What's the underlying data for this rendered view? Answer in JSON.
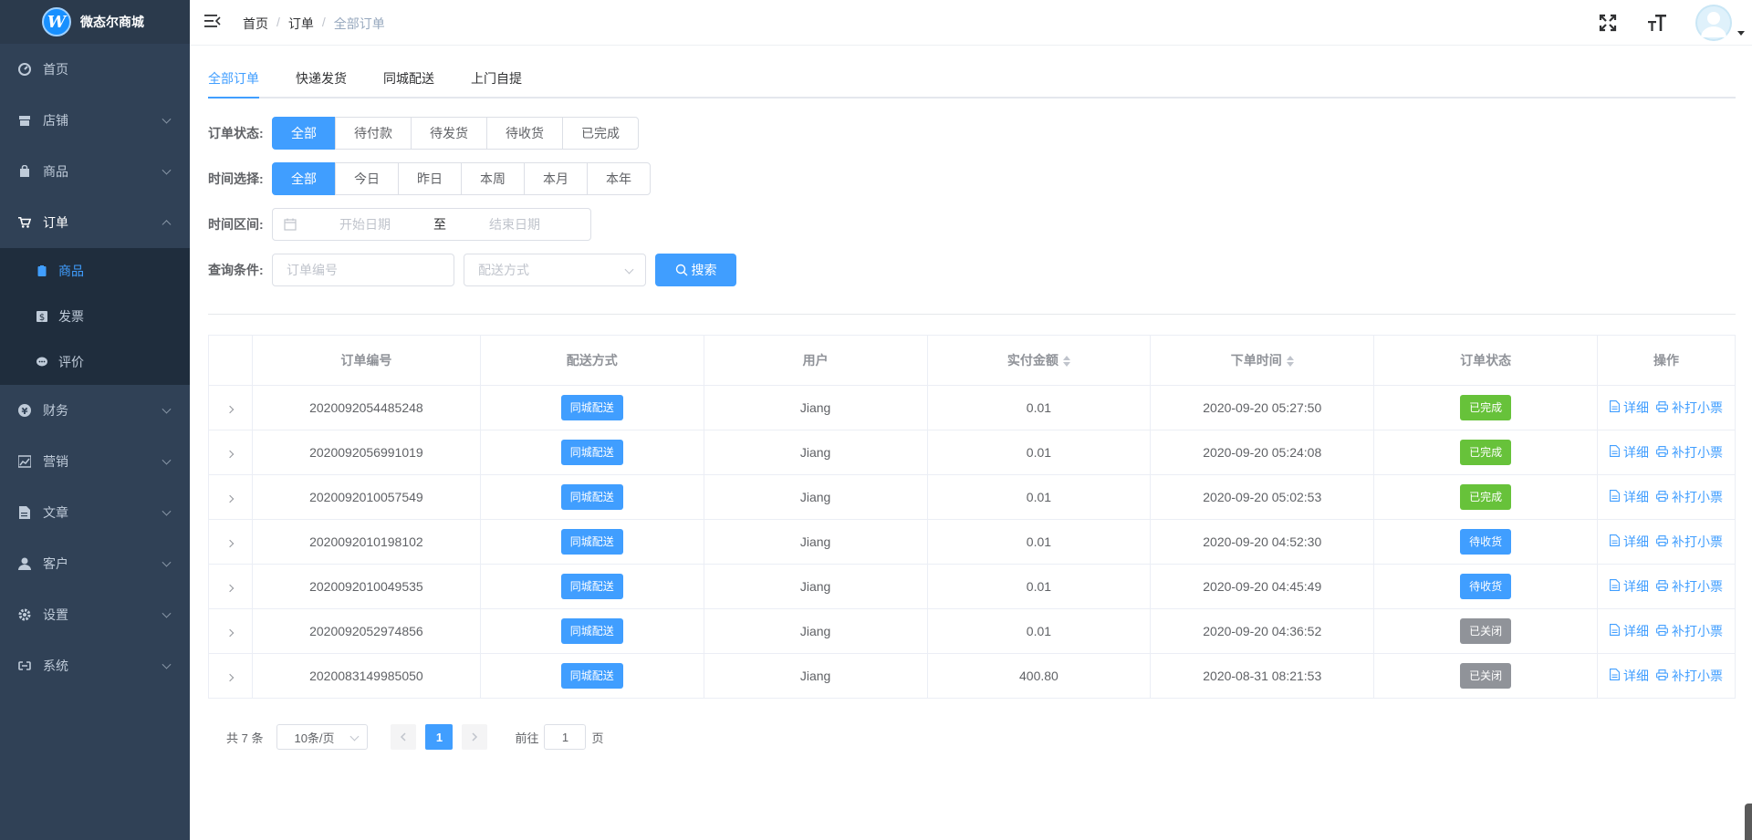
{
  "sidebar": {
    "logo_text": "微态尔商城",
    "logo_mark": "W",
    "items": [
      {
        "label": "首页",
        "icon": "dashboard-icon"
      },
      {
        "label": "店铺",
        "icon": "store-icon"
      },
      {
        "label": "商品",
        "icon": "bag-icon"
      },
      {
        "label": "订单",
        "icon": "cart-icon"
      },
      {
        "label": "财务",
        "icon": "yen-icon"
      },
      {
        "label": "营销",
        "icon": "chart-icon"
      },
      {
        "label": "文章",
        "icon": "document-icon"
      },
      {
        "label": "客户",
        "icon": "user-icon"
      },
      {
        "label": "设置",
        "icon": "gear-icon"
      },
      {
        "label": "系统",
        "icon": "link-icon"
      }
    ],
    "order_sub": [
      {
        "label": "商品",
        "icon": "clipboard-icon"
      },
      {
        "label": "发票",
        "icon": "invoice-icon"
      },
      {
        "label": "评价",
        "icon": "comment-icon"
      }
    ]
  },
  "header": {
    "breadcrumb": [
      "首页",
      "订单",
      "全部订单"
    ]
  },
  "tabs": [
    "全部订单",
    "快递发货",
    "同城配送",
    "上门自提"
  ],
  "filters": {
    "status_label": "订单状态:",
    "status_options": [
      "全部",
      "待付款",
      "待发货",
      "待收货",
      "已完成"
    ],
    "time_label": "时间选择:",
    "time_options": [
      "全部",
      "今日",
      "昨日",
      "本周",
      "本月",
      "本年"
    ],
    "range_label": "时间区间:",
    "start_placeholder": "开始日期",
    "range_to": "至",
    "end_placeholder": "结束日期",
    "query_label": "查询条件:",
    "order_no_placeholder": "订单编号",
    "delivery_placeholder": "配送方式",
    "search_label": "搜索"
  },
  "table": {
    "headers": [
      "订单编号",
      "配送方式",
      "用户",
      "实付金额",
      "下单时间",
      "订单状态",
      "操作"
    ],
    "detail_label": "详细",
    "reprint_label": "补打小票",
    "rows": [
      {
        "order_no": "2020092054485248",
        "delivery": "同城配送",
        "user": "Jiang",
        "amount": "0.01",
        "time": "2020-09-20 05:27:50",
        "status": "已完成",
        "status_color": "#67c23a"
      },
      {
        "order_no": "2020092056991019",
        "delivery": "同城配送",
        "user": "Jiang",
        "amount": "0.01",
        "time": "2020-09-20 05:24:08",
        "status": "已完成",
        "status_color": "#67c23a"
      },
      {
        "order_no": "2020092010057549",
        "delivery": "同城配送",
        "user": "Jiang",
        "amount": "0.01",
        "time": "2020-09-20 05:02:53",
        "status": "已完成",
        "status_color": "#67c23a"
      },
      {
        "order_no": "2020092010198102",
        "delivery": "同城配送",
        "user": "Jiang",
        "amount": "0.01",
        "time": "2020-09-20 04:52:30",
        "status": "待收货",
        "status_color": "#409eff"
      },
      {
        "order_no": "2020092010049535",
        "delivery": "同城配送",
        "user": "Jiang",
        "amount": "0.01",
        "time": "2020-09-20 04:45:49",
        "status": "待收货",
        "status_color": "#409eff"
      },
      {
        "order_no": "2020092052974856",
        "delivery": "同城配送",
        "user": "Jiang",
        "amount": "0.01",
        "time": "2020-09-20 04:36:52",
        "status": "已关闭",
        "status_color": "#909399"
      },
      {
        "order_no": "2020083149985050",
        "delivery": "同城配送",
        "user": "Jiang",
        "amount": "400.80",
        "time": "2020-08-31 08:21:53",
        "status": "已关闭",
        "status_color": "#909399"
      }
    ]
  },
  "pagination": {
    "total": "共 7 条",
    "page_size": "10条/页",
    "current_page": "1",
    "goto_prefix": "前往",
    "goto_value": "1",
    "goto_suffix": "页"
  },
  "colors": {
    "accent": "#409eff",
    "sidebar_bg": "#304156",
    "success": "#67c23a",
    "closed": "#909399"
  }
}
